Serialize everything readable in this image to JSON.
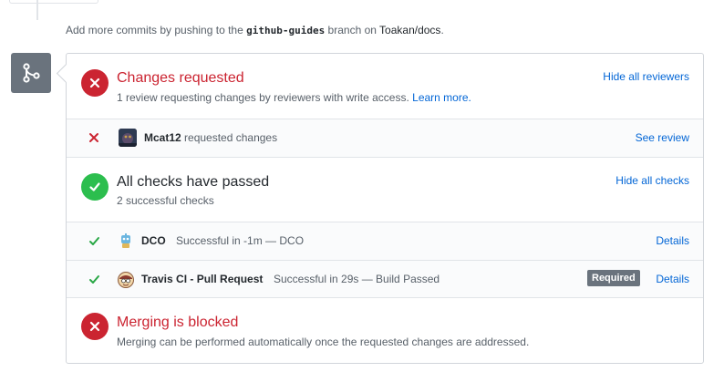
{
  "hint": {
    "prefix": "Add more commits by pushing to the",
    "branch": "github-guides",
    "middle": "branch on",
    "repo": "Toakan/docs",
    "suffix": "."
  },
  "changes": {
    "title": "Changes requested",
    "subtitle": "1 review requesting changes by reviewers with write access.",
    "learn_more": "Learn more.",
    "toggle": "Hide all reviewers"
  },
  "reviewer": {
    "name": "Mcat12",
    "action": "requested changes",
    "link": "See review"
  },
  "checks": {
    "title": "All checks have passed",
    "subtitle": "2 successful checks",
    "toggle": "Hide all checks",
    "items": [
      {
        "name": "DCO",
        "description": "Successful in -1m — DCO",
        "link": "Details",
        "required": ""
      },
      {
        "name": "Travis CI - Pull Request",
        "description": "Successful in 29s — Build Passed",
        "link": "Details",
        "required": "Required"
      }
    ]
  },
  "blocked": {
    "title": "Merging is blocked",
    "subtitle": "Merging can be performed automatically once the requested changes are addressed."
  },
  "colors": {
    "danger": "#cb2431",
    "success": "#2cbe4e",
    "link": "#0366d6",
    "badge": "#6a737d"
  },
  "icons": {
    "merge": "git-merge-icon",
    "failure": "x-icon",
    "success": "check-icon"
  }
}
